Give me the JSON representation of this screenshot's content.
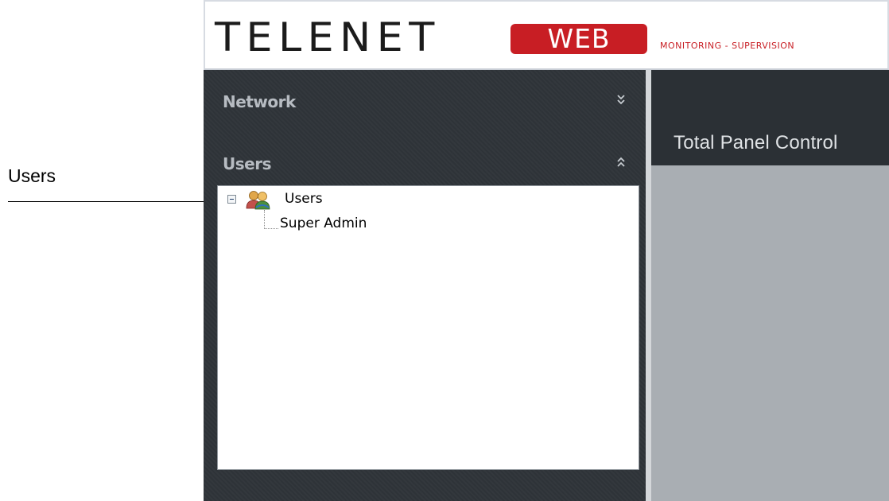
{
  "annotation": {
    "callout_label": "Users"
  },
  "header": {
    "logo_main": "TELENET",
    "logo_box": "WEB",
    "logo_tagline": "MONITORING - SUPERVISION"
  },
  "sidebar": {
    "sections": [
      {
        "title": "Network",
        "state": "collapsed",
        "icon": "chevron-double-down-icon"
      },
      {
        "title": "Users",
        "state": "expanded",
        "icon": "chevron-double-up-icon"
      }
    ],
    "tree": {
      "root": {
        "label": "Users",
        "icon": "users-group-icon",
        "expanded": true
      },
      "children": [
        {
          "label": "Super Admin"
        }
      ]
    }
  },
  "main": {
    "title": "Total Panel Control"
  },
  "colors": {
    "brand_red": "#c81e24",
    "sidebar_bg": "#2e3338",
    "main_bg": "#a9aeb3",
    "section_title": "#b7bcc2"
  }
}
